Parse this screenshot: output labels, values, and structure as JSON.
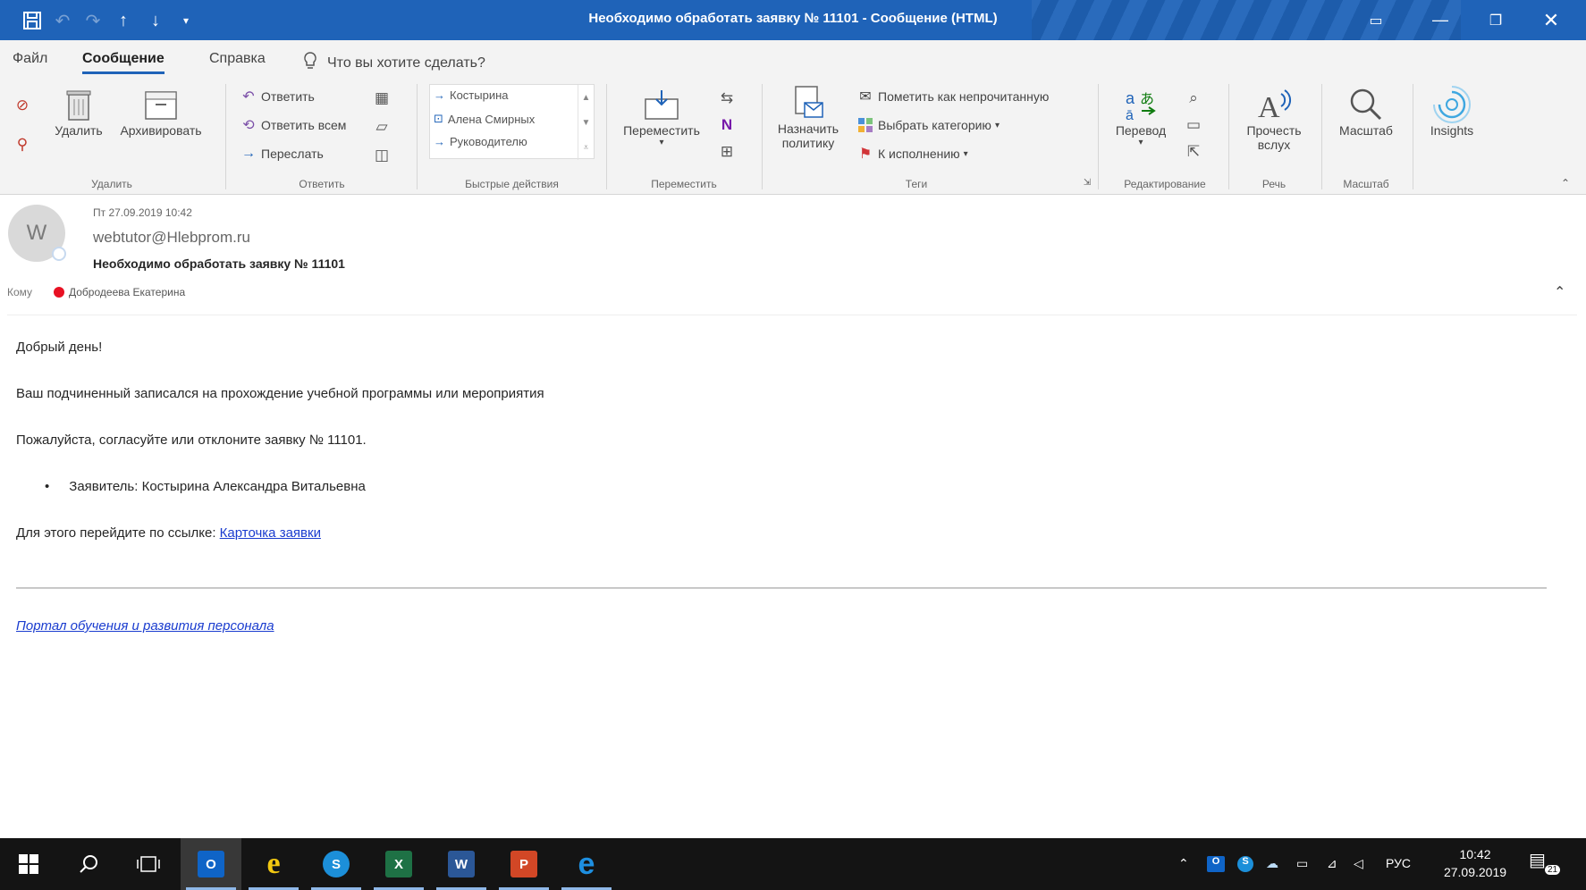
{
  "window": {
    "title": "Необходимо обработать заявку № 11101  -  Сообщение (HTML)"
  },
  "menu": {
    "tabs": [
      {
        "label": "Файл"
      },
      {
        "label": "Сообщение"
      },
      {
        "label": "Справка"
      }
    ],
    "tell_me_placeholder": "Что вы хотите сделать?"
  },
  "ribbon": {
    "delete_group": {
      "delete": "Удалить",
      "archive": "Архивировать",
      "label": "Удалить"
    },
    "respond_group": {
      "reply": "Ответить",
      "reply_all": "Ответить всем",
      "forward": "Переслать",
      "label": "Ответить"
    },
    "quick_steps": {
      "items": [
        "Костырина",
        "Алена Смирных",
        "Руководителю"
      ],
      "label": "Быстрые действия"
    },
    "move_group": {
      "move": "Переместить",
      "label": "Переместить"
    },
    "tags_group": {
      "policy_line1": "Назначить",
      "policy_line2": "политику",
      "mark_unread": "Пометить как непрочитанную",
      "categorize": "Выбрать категорию",
      "follow_up": "К исполнению",
      "label": "Теги"
    },
    "editing_group": {
      "translate": "Перевод",
      "label": "Редактирование"
    },
    "speech_group": {
      "read_line1": "Прочесть",
      "read_line2": "вслух",
      "label": "Речь"
    },
    "zoom_group": {
      "zoom": "Масштаб",
      "label": "Масштаб"
    },
    "insights": {
      "label": "Insights"
    }
  },
  "message": {
    "avatar_initial": "W",
    "date": "Пт 27.09.2019 10:42",
    "sender": "webtutor@Hlebprom.ru",
    "subject": "Необходимо обработать заявку № 11101",
    "to_label": "Кому",
    "recipient": "Добродеева Екатерина",
    "body": {
      "greeting": "Добрый день!",
      "line1": "Ваш подчиненный записался на прохождение учебной программы или мероприятия",
      "line2": "Пожалуйста, согласуйте или отклоните заявку № 11101.",
      "bullet": "Заявитель: Костырина Александра Витальевна",
      "link_prefix": "Для этого перейдите по ссылке: ",
      "link_text": "Карточка заявки",
      "portal_link": "Портал обучения и развития персонала"
    }
  },
  "taskbar": {
    "language": "РУС",
    "time": "10:42",
    "date": "27.09.2019",
    "notification_count": "21"
  },
  "colors": {
    "titlebar": "#1f63b8",
    "ribbon_bg": "#f3f3f3",
    "link": "#1a3ccf",
    "taskbar": "#141414",
    "presence_dot": "#e81123"
  }
}
